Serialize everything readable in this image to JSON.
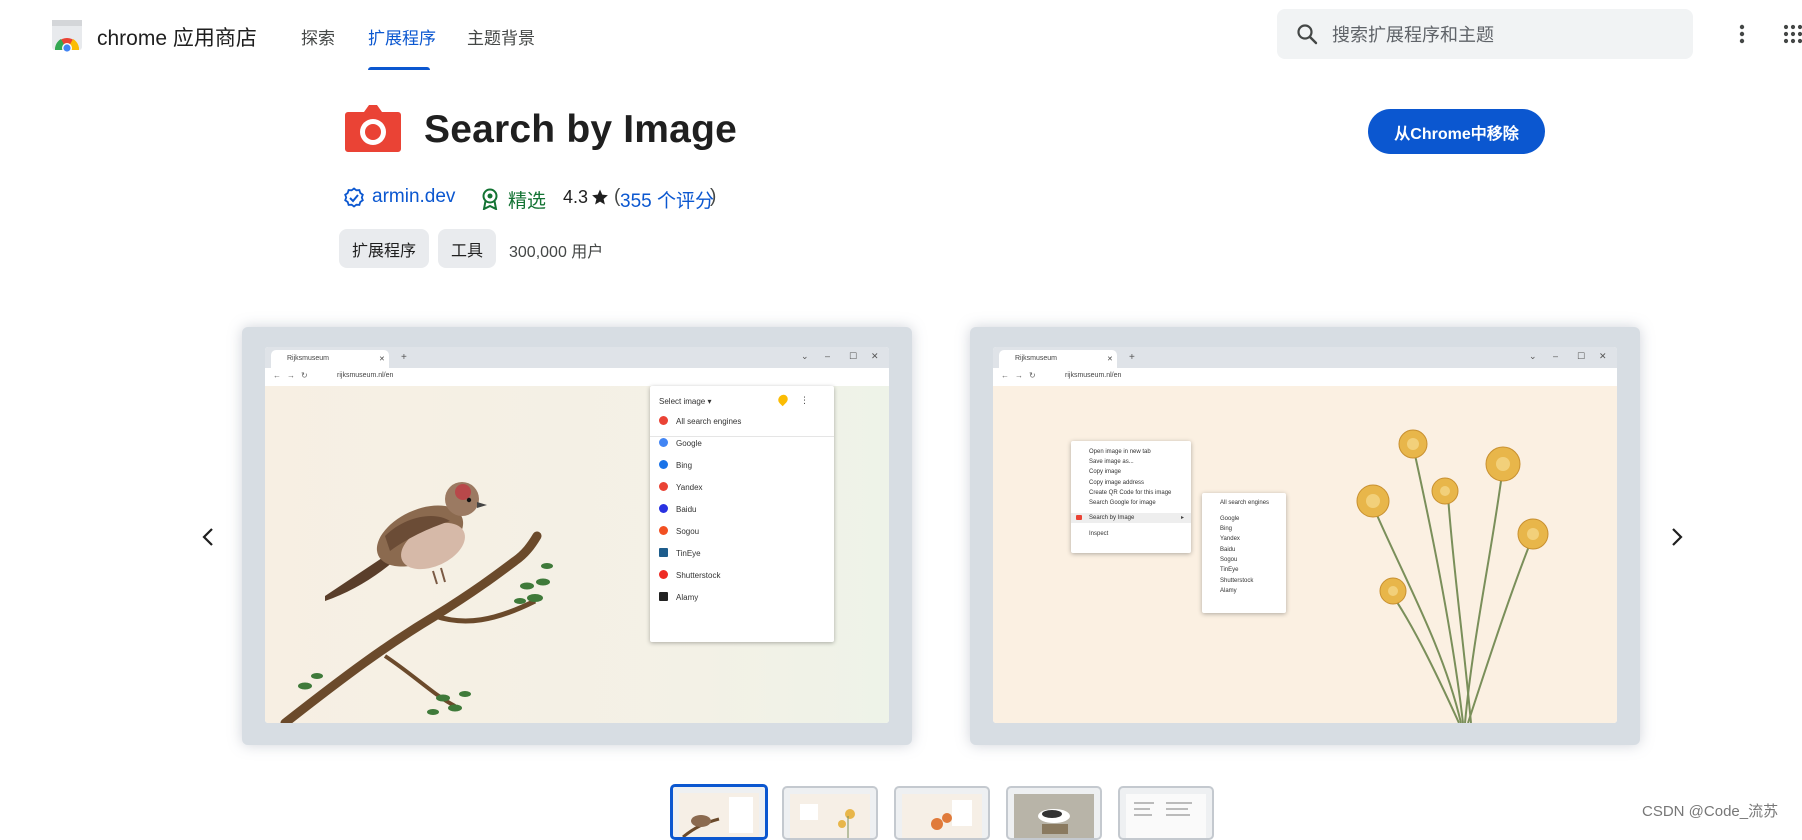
{
  "header": {
    "brand": "chrome 应用商店",
    "nav_tabs": [
      {
        "label": "探索",
        "active": false
      },
      {
        "label": "扩展程序",
        "active": true
      },
      {
        "label": "主题背景",
        "active": false
      }
    ],
    "search_placeholder": "搜索扩展程序和主题"
  },
  "extension": {
    "title": "Search by Image",
    "developer": "armin.dev",
    "featured_label": "精选",
    "rating": "4.3",
    "rating_open": "(",
    "rating_count": "355 个评分",
    "rating_close": ")",
    "categories": [
      "扩展程序",
      "工具"
    ],
    "users": "300,000 用户",
    "remove_button": "从Chrome中移除"
  },
  "screenshots": {
    "slide1": {
      "tab_title": "Rijksmuseum",
      "url": "rijksmuseum.nl/en",
      "popup_header": "Select image ▾",
      "popup_all": "All search engines",
      "engines": [
        "Google",
        "Bing",
        "Yandex",
        "Baidu",
        "Sogou",
        "TinEye",
        "Shutterstock",
        "Alamy"
      ]
    },
    "slide2": {
      "tab_title": "Rijksmuseum",
      "url": "rijksmuseum.nl/en",
      "context_menu": [
        "Open image in new tab",
        "Save image as...",
        "Copy image",
        "Copy image address",
        "Create QR Code for this image",
        "Search Google for image",
        "Search by Image",
        "Inspect"
      ],
      "submenu": [
        "All search engines",
        "Google",
        "Bing",
        "Yandex",
        "Baidu",
        "Sogou",
        "TinEye",
        "Shutterstock",
        "Alamy"
      ]
    },
    "thumbnail_count": 5,
    "active_thumbnail": 1
  },
  "watermark": "CSDN @Code_流苏",
  "colors": {
    "accent": "#0b57d0",
    "featured": "#137333",
    "icon_red": "#ea4335"
  },
  "icons": [
    "chrome-logo-icon",
    "search-icon",
    "more-vert-icon",
    "apps-grid-icon",
    "camera-icon",
    "verified-icon",
    "featured-badge-icon",
    "star-icon",
    "chevron-left-icon",
    "chevron-right-icon"
  ]
}
